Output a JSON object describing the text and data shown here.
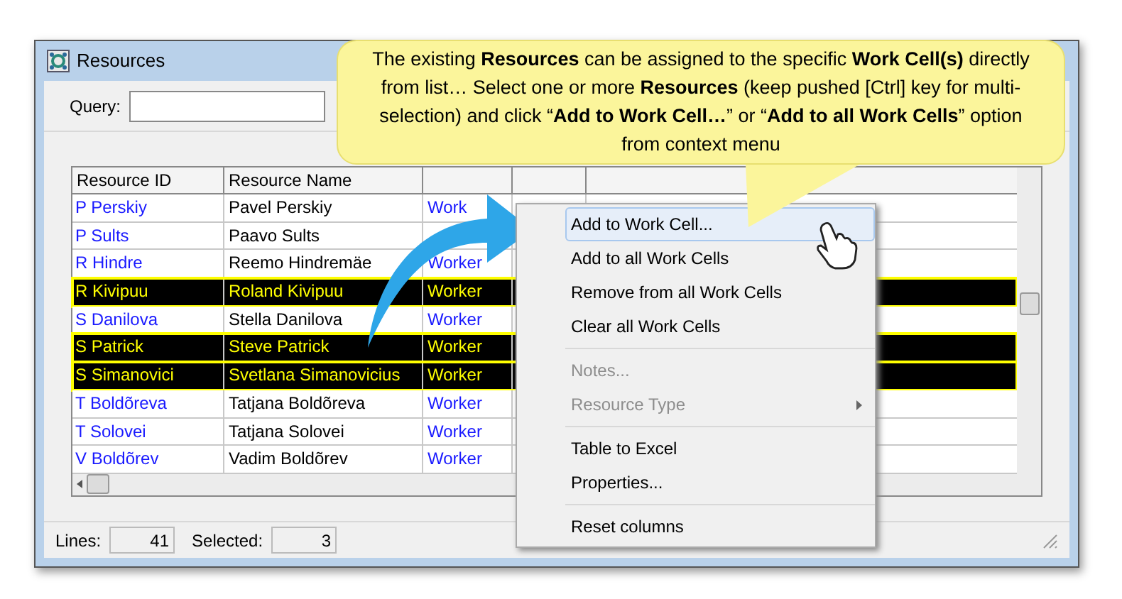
{
  "window": {
    "title": "Resources"
  },
  "query": {
    "label": "Query:"
  },
  "table": {
    "columns": [
      "Resource ID",
      "Resource Name"
    ],
    "rows": [
      {
        "id": "P Perskiy",
        "name": "Pavel Perskiy",
        "type": "Work",
        "selected": false
      },
      {
        "id": "P Sults",
        "name": "Paavo Sults",
        "selected": false
      },
      {
        "id": "R Hindre",
        "name": "Reemo Hindremäe",
        "type": "Worker",
        "selected": false
      },
      {
        "id": "R Kivipuu",
        "name": "Roland Kivipuu",
        "type": "Worker",
        "selected": true
      },
      {
        "id": "S Danilova",
        "name": "Stella Danilova",
        "type": "Worker",
        "selected": false
      },
      {
        "id": "S Patrick",
        "name": "Steve Patrick",
        "type": "Worker",
        "selected": true
      },
      {
        "id": "S Simanovici",
        "name": "Svetlana Simanovicius",
        "type": "Worker",
        "selected": true
      },
      {
        "id": "T Boldõreva",
        "name": "Tatjana Boldõreva",
        "type": "Worker",
        "selected": false
      },
      {
        "id": "T Solovei",
        "name": "Tatjana Solovei",
        "type": "Worker",
        "selected": false
      },
      {
        "id": "V Boldõrev",
        "name": "Vadim Boldõrev",
        "type": "Worker",
        "selected": false
      }
    ]
  },
  "status_bar": {
    "lines_label": "Lines:",
    "lines": "41",
    "selected_label": "Selected:",
    "selected": "3"
  },
  "context_menu": {
    "groups": [
      [
        {
          "label": "Add to Work Cell...",
          "selected": true,
          "disabled": false
        },
        {
          "label": "Add to all Work Cells",
          "selected": false,
          "disabled": false
        },
        {
          "label": "Remove from all Work Cells",
          "selected": false,
          "disabled": false
        },
        {
          "label": "Clear all Work Cells",
          "selected": false,
          "disabled": false
        }
      ],
      [
        {
          "label": "Notes...",
          "selected": false,
          "disabled": true
        },
        {
          "label": "Resource Type",
          "selected": false,
          "disabled": true,
          "submenu": true
        }
      ],
      [
        {
          "label": "Table to Excel",
          "selected": false,
          "disabled": false
        },
        {
          "label": "Properties...",
          "selected": false,
          "disabled": false
        }
      ],
      [
        {
          "label": "Reset columns",
          "selected": false,
          "disabled": false
        }
      ]
    ]
  },
  "callout": {
    "text": "The existing **Resources** can be assigned to the specific **Work Cell(s)** directly from list… Select one or more **Resources** (keep pushed [Ctrl] key for multi-selection) and click “**Add to Work Cell…**” or “**Add to all Work Cells**” option from context menu"
  }
}
